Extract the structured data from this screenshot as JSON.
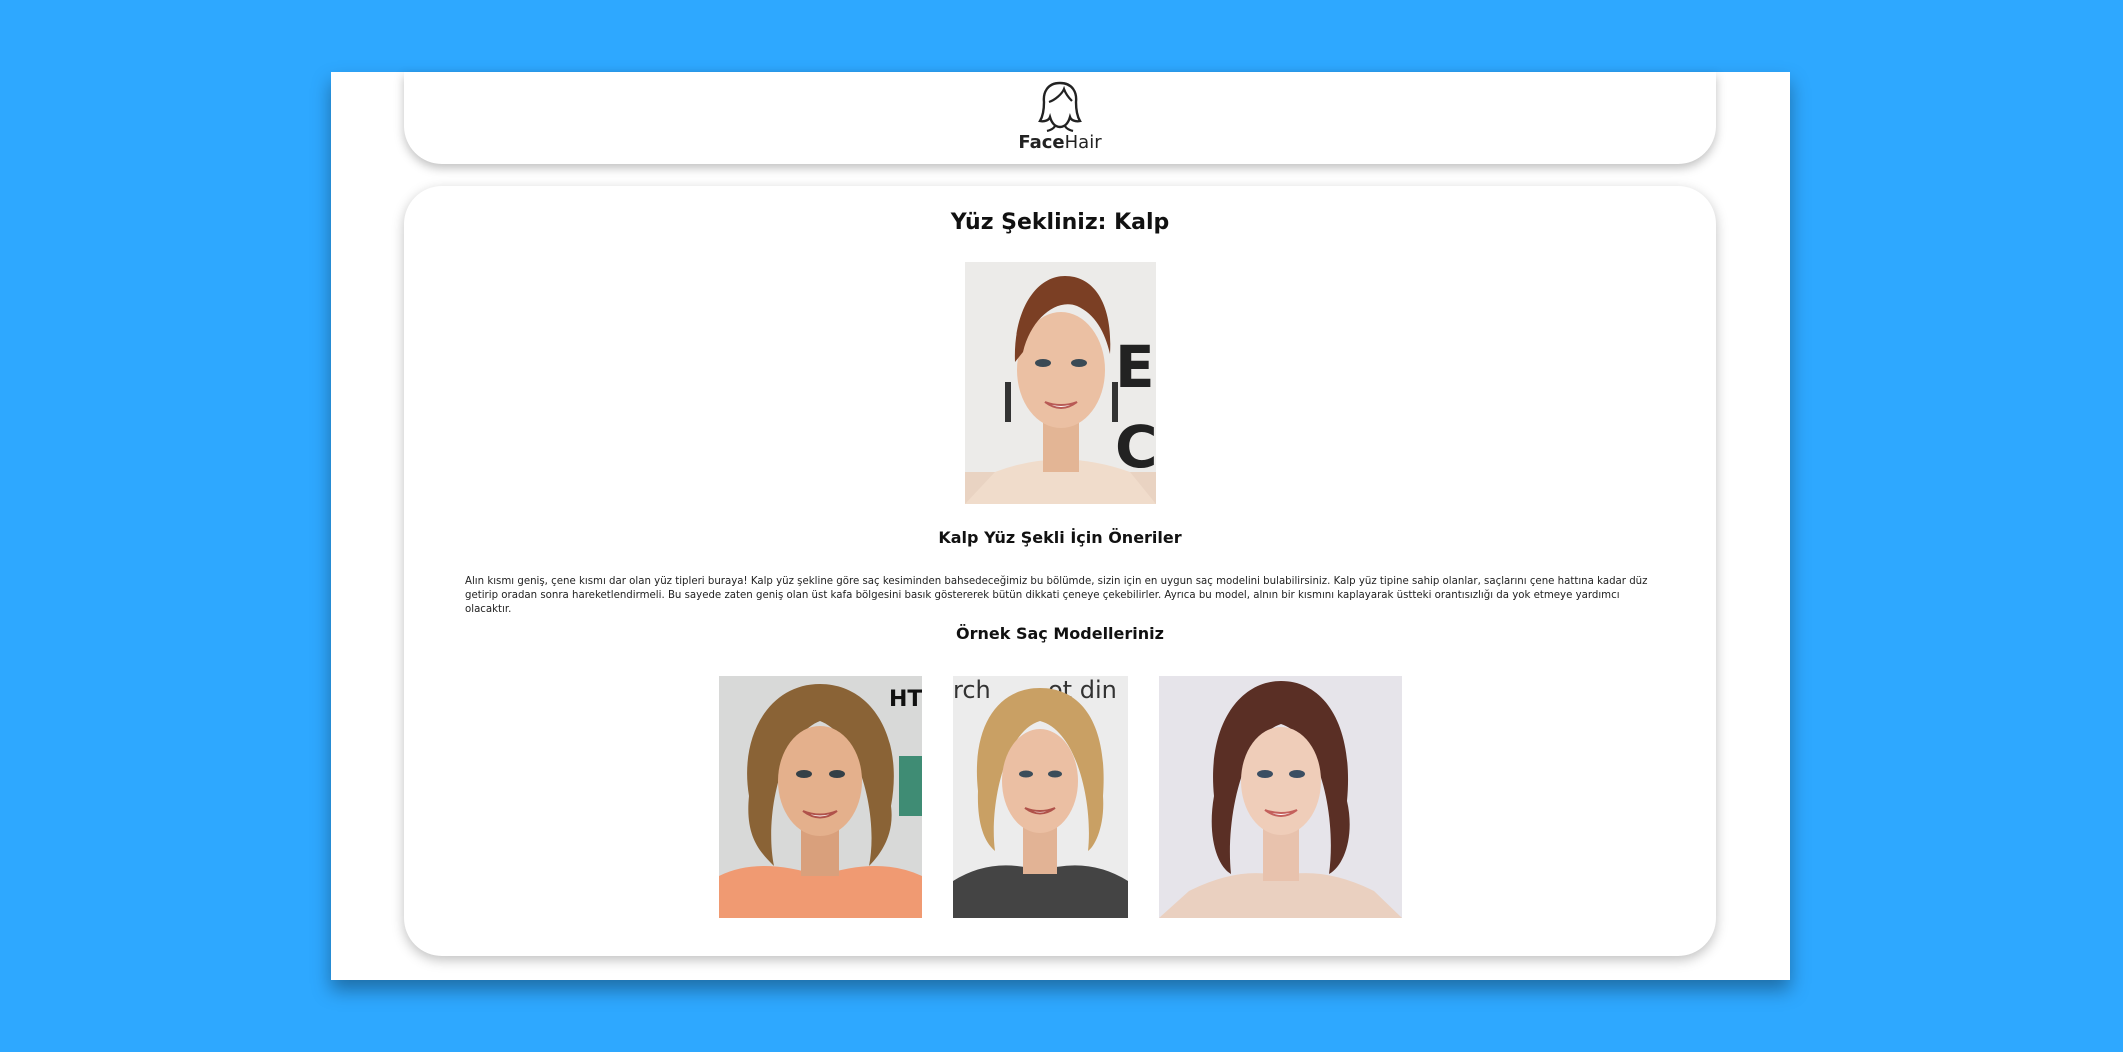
{
  "colors": {
    "background": "#2ea8ff",
    "card": "#ffffff",
    "text": "#111111"
  },
  "header": {
    "logo_icon": "woman-face-icon",
    "logo_bold": "Face",
    "logo_light": "Hair"
  },
  "main": {
    "title": "Yüz Şekliniz: Kalp",
    "face_photo": "heart-face-portrait",
    "subtitle": "Kalp Yüz Şekli İçin Öneriler",
    "description": "Alın kısmı geniş, çene kısmı dar olan yüz tipleri buraya! Kalp yüz şekline göre saç kesiminden bahsedeceğimiz bu bölümde, sizin için en uygun saç modelini bulabilirsiniz. Kalp yüz tipine sahip olanlar, saçlarını çene hattına kadar düz getirip oradan sonra hareketlendirmeli. Bu sayede zaten geniş olan üst kafa bölgesini basık göstererek bütün dikkati çeneye çekebilirler. Ayrıca bu model, alnın bir kısmını kaplayarak üstteki orantısızlığı da yok etmeye yardımcı olacaktır.",
    "models_heading": "Örnek Saç Modelleriniz",
    "models": [
      {
        "name": "curly-bob-model"
      },
      {
        "name": "blonde-lob-model"
      },
      {
        "name": "brunette-lob-model"
      }
    ]
  }
}
